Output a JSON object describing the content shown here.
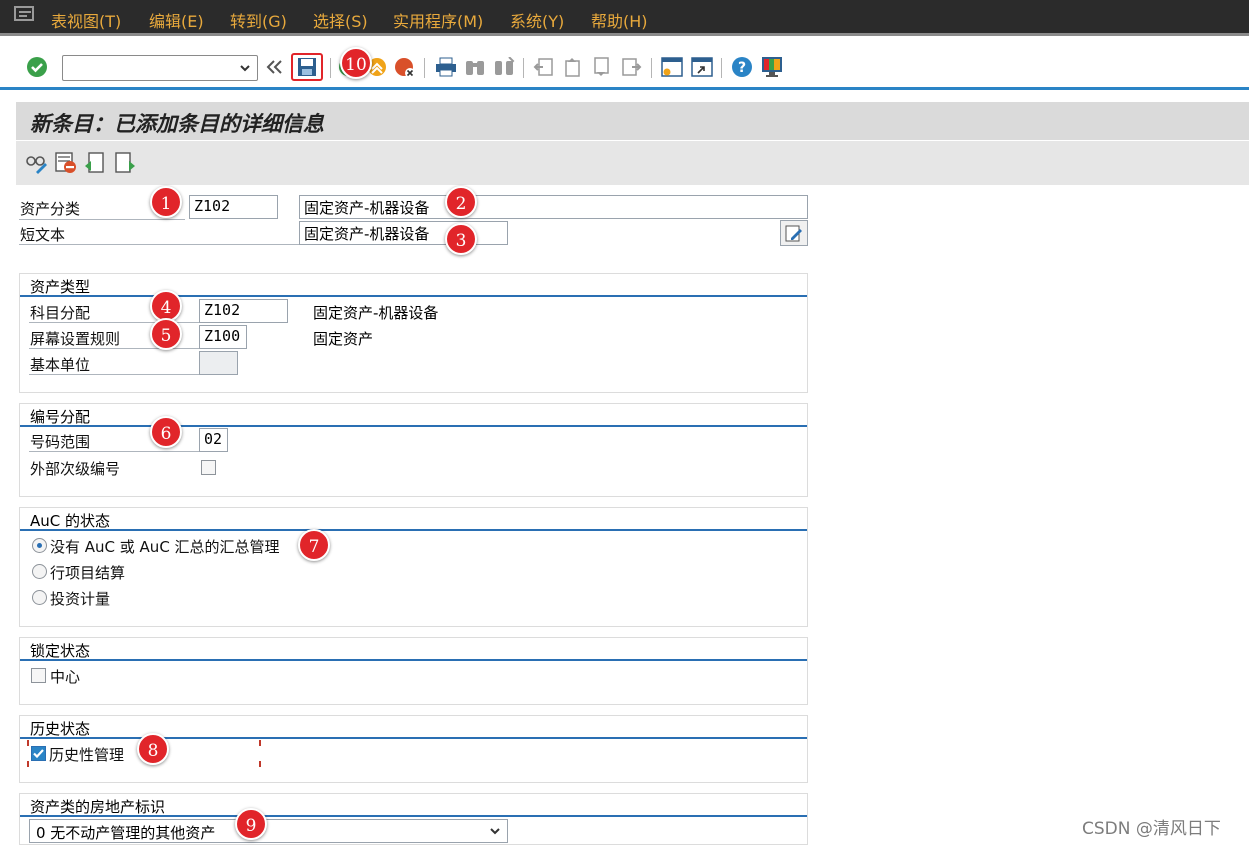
{
  "menubar": {
    "items": [
      "表视图(T)",
      "编辑(E)",
      "转到(G)",
      "选择(S)",
      "实用程序(M)",
      "系统(Y)",
      "帮助(H)"
    ]
  },
  "toolbar": {
    "command_field_value": "",
    "icons": [
      "enter-check-icon",
      "collapse-icon",
      "save-icon",
      "back-icon",
      "exit-icon",
      "cancel-icon",
      "print-icon",
      "find-icon",
      "find-next-icon",
      "first-page-icon",
      "previous-page-icon",
      "next-page-icon",
      "last-page-icon",
      "new-session-icon",
      "create-shortcut-icon",
      "help-icon",
      "customize-layout-icon"
    ]
  },
  "title": "新条目：已添加条目的详细信息",
  "header": {
    "asset_class_label": "资产分类",
    "asset_class_value": "Z102",
    "asset_class_desc": "固定资产-机器设备",
    "short_text_label": "短文本",
    "short_text_value": "固定资产-机器设备"
  },
  "asset_type": {
    "title": "资产类型",
    "account_determination_label": "科目分配",
    "account_determination_value": "Z102",
    "account_determination_desc": "固定资产-机器设备",
    "screen_layout_label": "屏幕设置规则",
    "screen_layout_value": "Z100",
    "screen_layout_desc": "固定资产",
    "base_unit_label": "基本单位",
    "base_unit_value": ""
  },
  "number_assignment": {
    "title": "编号分配",
    "number_range_label": "号码范围",
    "number_range_value": "02",
    "external_sub_label": "外部次级编号",
    "external_sub_checked": false
  },
  "auc_status": {
    "title": "AuC 的状态",
    "options": [
      "没有 AuC 或 AuC 汇总的汇总管理",
      "行项目结算",
      "投资计量"
    ],
    "selected_index": 0
  },
  "lock_status": {
    "title": "锁定状态",
    "central_label": "中心",
    "central_checked": false
  },
  "history_status": {
    "title": "历史状态",
    "history_label": "历史性管理",
    "history_checked": true
  },
  "real_estate": {
    "title": "资产类的房地产标识",
    "selected_value": "0 无不动产管理的其他资产"
  },
  "annotations": [
    "1",
    "2",
    "3",
    "4",
    "5",
    "6",
    "7",
    "8",
    "9",
    "10"
  ],
  "watermark": "CSDN @清风日下",
  "colors": {
    "menubar_bg": "#2b2b2b",
    "menu_text": "#e8a93c",
    "accent_blue": "#2a84c6",
    "badge_red": "#e1252a"
  }
}
